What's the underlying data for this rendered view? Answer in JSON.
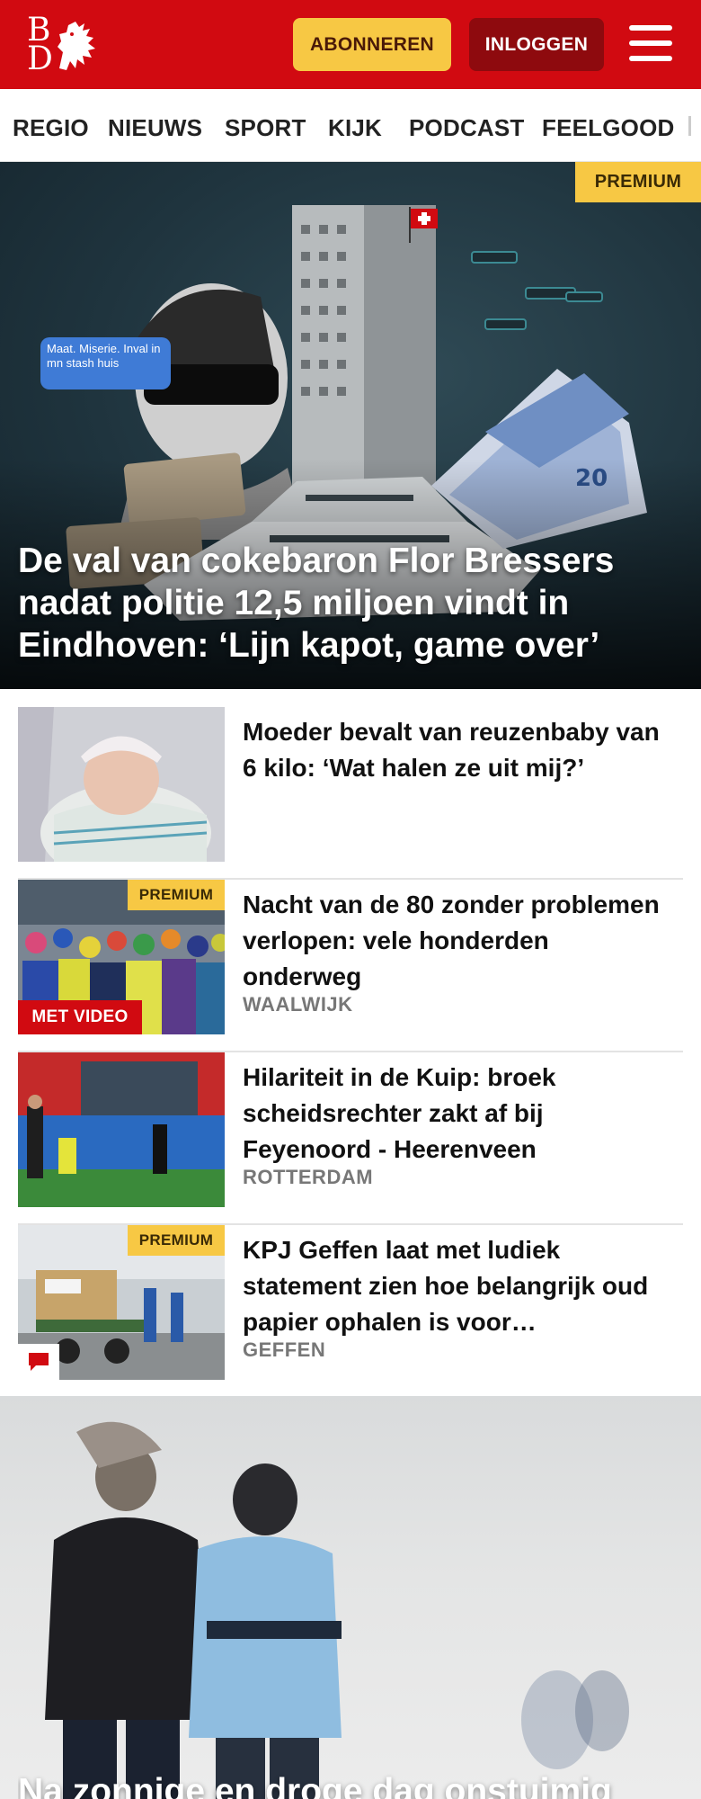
{
  "header": {
    "logo_text_top": "B",
    "logo_text_bottom": "D",
    "subscribe_label": "ABONNEREN",
    "login_label": "INLOGGEN",
    "brand_color": "#d10a11",
    "menu_icon": "hamburger-menu-icon"
  },
  "nav": {
    "items": [
      "REGIO",
      "NIEUWS",
      "SPORT",
      "KIJK",
      "PODCAST",
      "FEELGOOD"
    ]
  },
  "hero": {
    "badge": "PREMIUM",
    "title": "De val van cokebaron Flor Bressers nadat politie 12,5 miljoen vindt in Eindhoven: ‘Lijn kapot, game over’",
    "chat_bubble_text": "Maat. Miserie. Inval in mn stash huis",
    "banknote_value": "20"
  },
  "articles": [
    {
      "title": "Moeder bevalt van reuzenbaby van 6 kilo: ‘Wat halen ze uit mij?’",
      "location": "",
      "premium": false,
      "video": false,
      "comments": false
    },
    {
      "title": "Nacht van de 80 zonder problemen verlopen: vele honderden onderweg",
      "location": "WAALWIJK",
      "premium": true,
      "premium_label": "PREMIUM",
      "video": true,
      "video_label": "MET VIDEO",
      "comments": false
    },
    {
      "title": "Hilariteit in de Kuip: broek scheidsrechter zakt af bij Feyenoord - Heerenveen",
      "location": "ROTTERDAM",
      "premium": false,
      "video": false,
      "comments": false
    },
    {
      "title": "KPJ Geffen laat met ludiek statement zien hoe belangrijk oud papier ophalen is voor…",
      "location": "GEFFEN",
      "premium": true,
      "premium_label": "PREMIUM",
      "video": false,
      "comments": true,
      "comment_icon": "comment-icon"
    }
  ],
  "hero2": {
    "title": "Na zonnige en droge dag onstuimig"
  },
  "colors": {
    "premium": "#f7c844",
    "subscribe_bg": "#f7c844",
    "login_bg": "#8e0a0e",
    "video_badge": "#d10a11",
    "location_text": "#777777"
  }
}
